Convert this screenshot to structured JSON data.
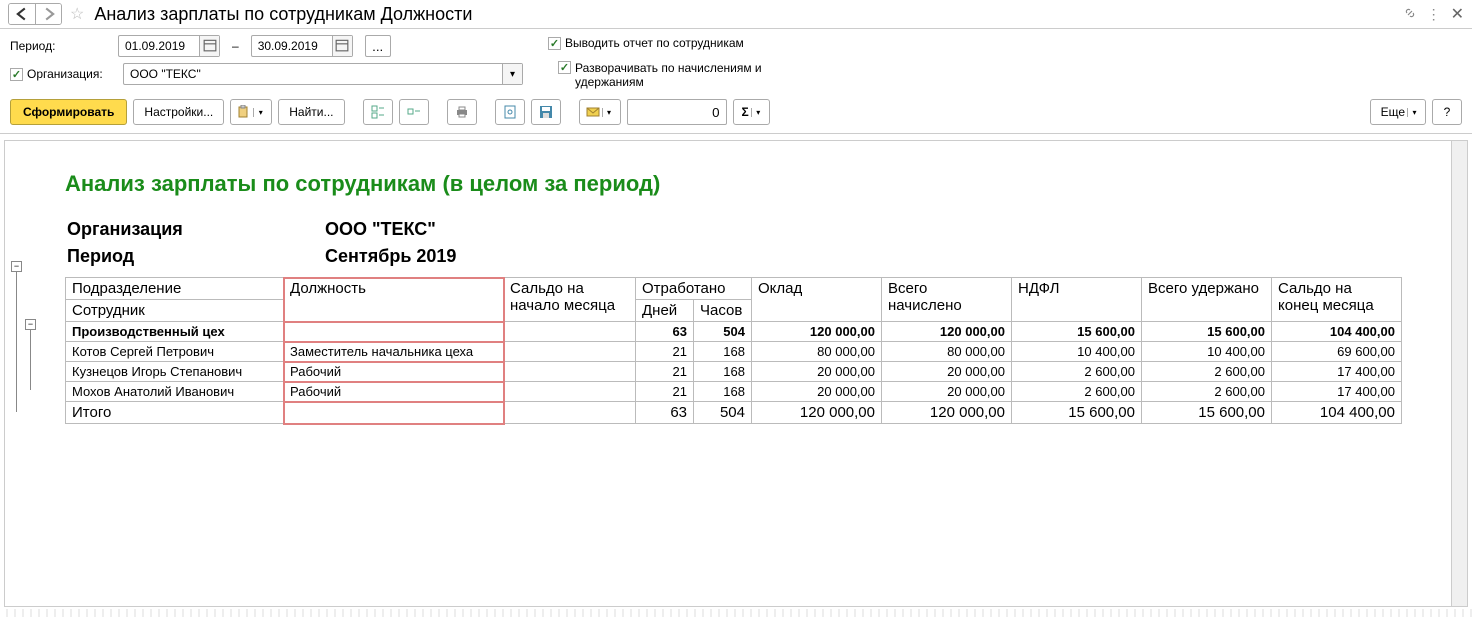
{
  "title": "Анализ зарплаты по сотрудникам Должности",
  "params": {
    "period_label": "Период:",
    "date_from": "01.09.2019",
    "date_to": "30.09.2019",
    "org_check_label": "Организация:",
    "org_value": "ООО \"ТЕКС\"",
    "check_by_employees": "Выводить отчет по сотрудникам",
    "check_expand": "Разворачивать по начислениям и удержаниям"
  },
  "toolbar": {
    "generate": "Сформировать",
    "settings": "Настройки...",
    "find": "Найти...",
    "num_value": "0",
    "more": "Еще",
    "help": "?"
  },
  "report": {
    "title": "Анализ зарплаты по сотрудникам (в целом за период)",
    "meta": {
      "org_label": "Организация",
      "org_value": "ООО \"ТЕКС\"",
      "period_label": "Период",
      "period_value": "Сентябрь 2019"
    },
    "headers": {
      "dept": "Подразделение",
      "employee": "Сотрудник",
      "position": "Должность",
      "saldo_begin": "Сальдо на начало месяца",
      "worked": "Отработано",
      "days": "Дней",
      "hours": "Часов",
      "salary": "Оклад",
      "accrued": "Всего начислено",
      "ndfl": "НДФЛ",
      "withheld": "Всего удержано",
      "saldo_end": "Сальдо на конец месяца"
    },
    "group": {
      "name": "Производственный цех",
      "days": "63",
      "hours": "504",
      "salary": "120 000,00",
      "accrued": "120 000,00",
      "ndfl": "15 600,00",
      "withheld": "15 600,00",
      "saldo_end": "104 400,00"
    },
    "rows": [
      {
        "name": "Котов Сергей Петрович",
        "pos": "Заместитель начальника цеха",
        "days": "21",
        "hours": "168",
        "salary": "80 000,00",
        "accrued": "80 000,00",
        "ndfl": "10 400,00",
        "withheld": "10 400,00",
        "saldo_end": "69 600,00"
      },
      {
        "name": "Кузнецов Игорь Степанович",
        "pos": "Рабочий",
        "days": "21",
        "hours": "168",
        "salary": "20 000,00",
        "accrued": "20 000,00",
        "ndfl": "2 600,00",
        "withheld": "2 600,00",
        "saldo_end": "17 400,00"
      },
      {
        "name": "Мохов Анатолий Иванович",
        "pos": "Рабочий",
        "days": "21",
        "hours": "168",
        "salary": "20 000,00",
        "accrued": "20 000,00",
        "ndfl": "2 600,00",
        "withheld": "2 600,00",
        "saldo_end": "17 400,00"
      }
    ],
    "total": {
      "label": "Итого",
      "days": "63",
      "hours": "504",
      "salary": "120 000,00",
      "accrued": "120 000,00",
      "ndfl": "15 600,00",
      "withheld": "15 600,00",
      "saldo_end": "104 400,00"
    }
  }
}
